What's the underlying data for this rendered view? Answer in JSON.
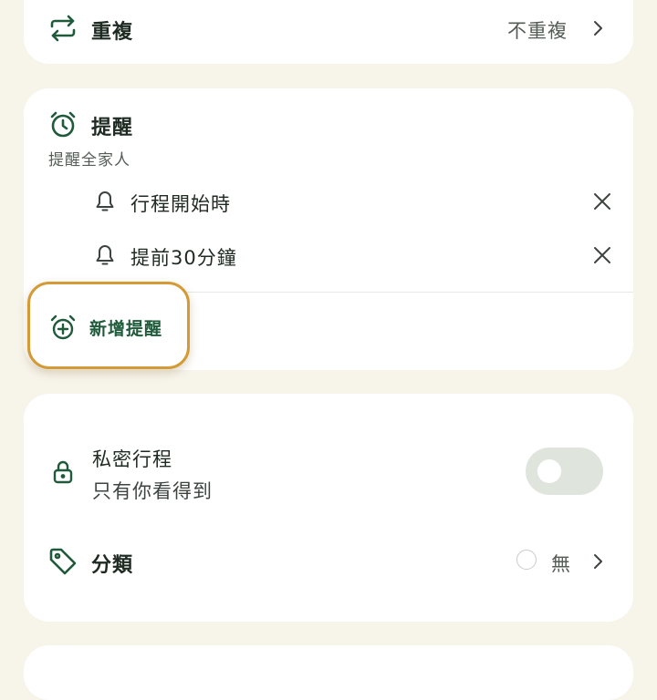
{
  "repeat": {
    "title": "重複",
    "value": "不重複"
  },
  "reminder": {
    "title": "提醒",
    "subtitle": "提醒全家人",
    "items": [
      {
        "label": "行程開始時"
      },
      {
        "label": "提前30分鐘"
      }
    ],
    "add_label": "新增提醒"
  },
  "private_event": {
    "title": "私密行程",
    "subtitle": "只有你看得到",
    "enabled": false
  },
  "category": {
    "title": "分類",
    "value": "無"
  },
  "colors": {
    "accent": "#1f5a3a",
    "highlight": "#d39a36",
    "background": "#f7f4ea"
  }
}
